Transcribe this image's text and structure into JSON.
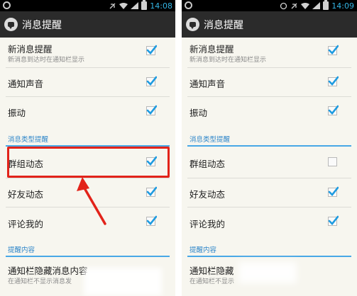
{
  "screens": [
    {
      "status_time": "14:08",
      "action_title": "消息提醒",
      "notify": {
        "title": "新消息提醒",
        "subtitle": "新消息到达时在通知栏显示",
        "checked": true
      },
      "sound": {
        "title": "通知声音",
        "checked": true
      },
      "vibrate": {
        "title": "振动",
        "checked": true
      },
      "type_header": "消息类型提醒",
      "group": {
        "title": "群组动态",
        "checked": true
      },
      "friend": {
        "title": "好友动态",
        "checked": true
      },
      "comment": {
        "title": "评论我的",
        "checked": true
      },
      "content_header": "提醒内容",
      "hide": {
        "title": "通知栏隐藏消息内容",
        "subtitle": "在通知栏不显示消息发"
      }
    },
    {
      "status_time": "14:09",
      "action_title": "消息提醒",
      "notify": {
        "title": "新消息提醒",
        "subtitle": "新消息到达时在通知栏显示",
        "checked": true
      },
      "sound": {
        "title": "通知声音",
        "checked": true
      },
      "vibrate": {
        "title": "振动",
        "checked": true
      },
      "type_header": "消息类型提醒",
      "group": {
        "title": "群组动态",
        "checked": false
      },
      "friend": {
        "title": "好友动态",
        "checked": true
      },
      "comment": {
        "title": "评论我的",
        "checked": true
      },
      "content_header": "提醒内容",
      "hide": {
        "title": "通知栏隐藏",
        "subtitle": "在通知栏不显示"
      }
    }
  ],
  "colors": {
    "accent": "#34b5e5",
    "header_blue": "#2e86c9",
    "highlight_red": "#e2231a",
    "check_blue": "#1e9be0"
  }
}
